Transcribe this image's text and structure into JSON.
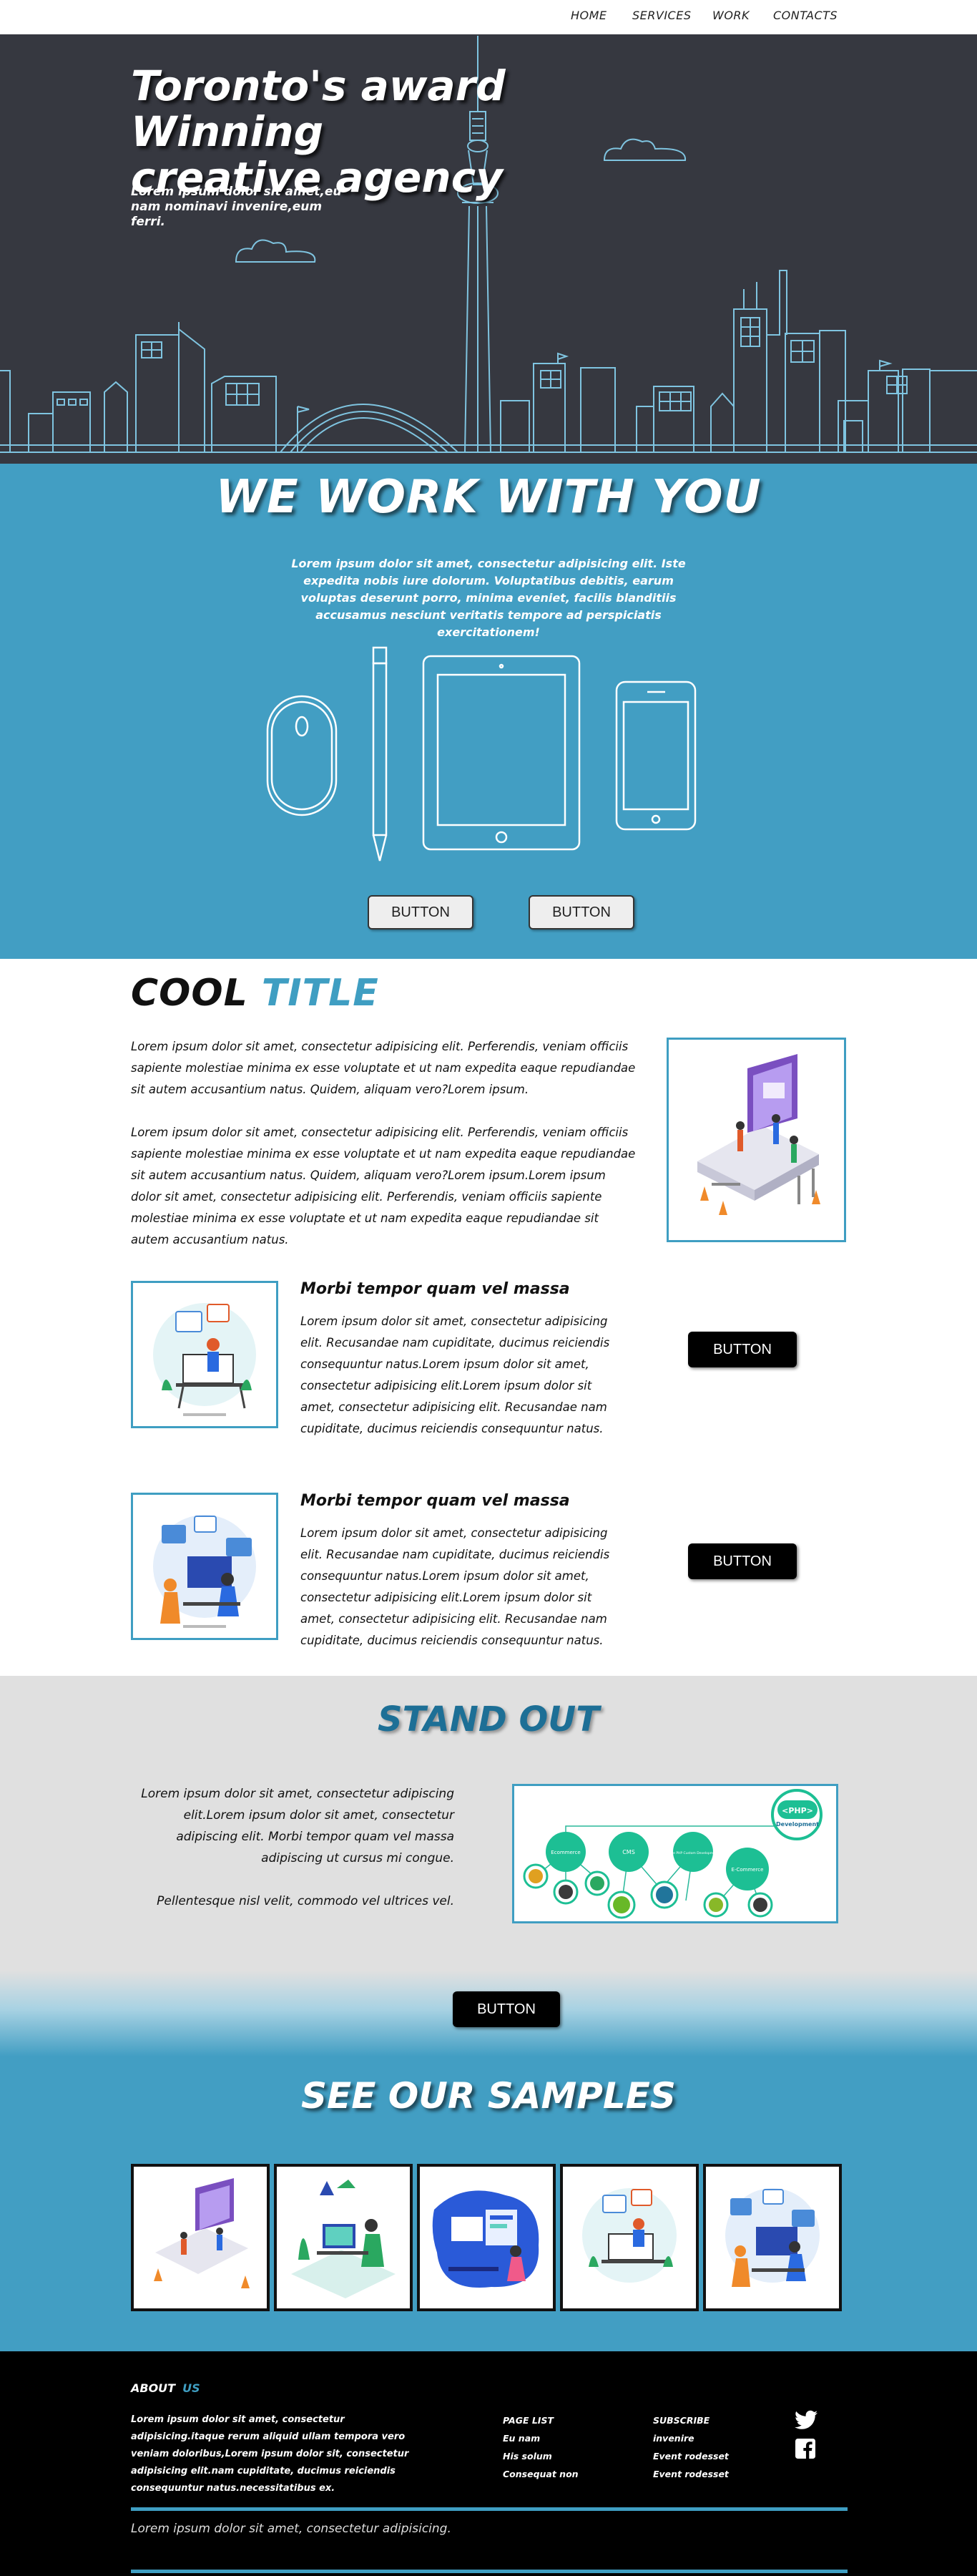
{
  "nav": {
    "items": [
      "HOME",
      "SERVICES",
      "WORK",
      "CONTACTS"
    ]
  },
  "hero": {
    "title_line1": "Toronto's award Winning",
    "title_line2": "creative agency",
    "subtitle_line1": "Lorem ipsum dolor sit amet,eu",
    "subtitle_line2": "nam nominavi invenire,eum ferri."
  },
  "work": {
    "title": "WE WORK WITH YOU",
    "text": "Lorem ipsum dolor sit amet, consectetur adipisicing elit. Iste expedita nobis iure dolorum. Voluptatibus debitis, earum voluptas deserunt porro, minima eveniet, facilis blanditiis accusamus nesciunt veritatis tempore ad perspiciatis exercitationem!",
    "button1": "BUTTON",
    "button2": "BUTTON"
  },
  "cool": {
    "title_word1": "COOL",
    "title_word2": "TITLE",
    "para1": "Lorem ipsum dolor sit amet, consectetur adipisicing elit. Perferendis, veniam officiis sapiente molestiae minima ex esse voluptate et ut nam expedita eaque repudiandae sit autem accusantium natus. Quidem, aliquam vero?Lorem ipsum.",
    "para2": "Lorem ipsum dolor sit amet, consectetur adipisicing elit. Perferendis, veniam officiis sapiente molestiae minima ex esse voluptate et ut nam expedita eaque repudiandae sit autem accusantium natus. Quidem, aliquam vero?Lorem ipsum.Lorem ipsum dolor sit amet, consectetur adipisicing elit. Perferendis, veniam officiis sapiente molestiae minima ex esse voluptate et ut nam expedita eaque repudiandae sit autem accusantium natus."
  },
  "features": [
    {
      "title": "Morbi tempor quam vel massa",
      "text": "Lorem ipsum dolor sit amet, consectetur adipisicing elit. Recusandae nam cupiditate, ducimus reiciendis consequuntur natus.Lorem ipsum dolor sit amet, consectetur adipisicing elit.Lorem ipsum dolor sit amet, consectetur adipisicing elit. Recusandae nam cupiditate, ducimus reiciendis consequuntur natus.",
      "button": "BUTTON"
    },
    {
      "title": "Morbi tempor quam vel massa",
      "text": "Lorem ipsum dolor sit amet, consectetur adipisicing elit. Recusandae nam cupiditate, ducimus reiciendis consequuntur natus.Lorem ipsum dolor sit amet, consectetur adipisicing elit.Lorem ipsum dolor sit amet, consectetur adipisicing elit. Recusandae nam cupiditate, ducimus reiciendis consequuntur natus.",
      "button": "BUTTON"
    }
  ],
  "stand": {
    "title": "STAND OUT",
    "text1": "Lorem ipsum dolor sit amet, consectetur adipiscing elit.Lorem ipsum dolor sit amet, consectetur adipiscing elit. Morbi tempor quam vel massa adipiscing ut cursus mi congue.",
    "text2": "Pellentesque nisl velit, commodo vel ultrices vel.",
    "button": "BUTTON",
    "diagram": {
      "php_label": "<PHP>",
      "php_sub": "Development",
      "nodes": [
        "Ecommerce",
        "CMS",
        "Core PHP Custom Development",
        "E-Commerce"
      ]
    }
  },
  "samples": {
    "title": "SEE OUR SAMPLES"
  },
  "footer": {
    "about": "ABOUT",
    "about_us": "US",
    "text": "Lorem ipsum dolor sit amet, consectetur adipisicing.itaque rerum aliquid ullam tempora vero veniam doloribus,Lorem ipsum dolor sit, consectetur adipisicing elit.nam cupiditate, ducimus reiciendis consequuntur natus.necessitatibus ex.",
    "page_list": {
      "heading": "PAGE LIST",
      "items": [
        "Eu nam",
        "His solum",
        "Consequat non"
      ]
    },
    "subscribe": {
      "heading": "SUBSCRIBE",
      "items": [
        "invenire",
        "Event rodesset",
        "Event rodesset"
      ]
    },
    "bottom_text": "Lorem ipsum dolor sit amet, consectetur adipisicing."
  },
  "colors": {
    "accent": "#429ec3",
    "hero_bg": "#363840",
    "line": "#7fc4e0",
    "dark": "#000000"
  },
  "icons": [
    "twitter-icon",
    "facebook-icon"
  ]
}
